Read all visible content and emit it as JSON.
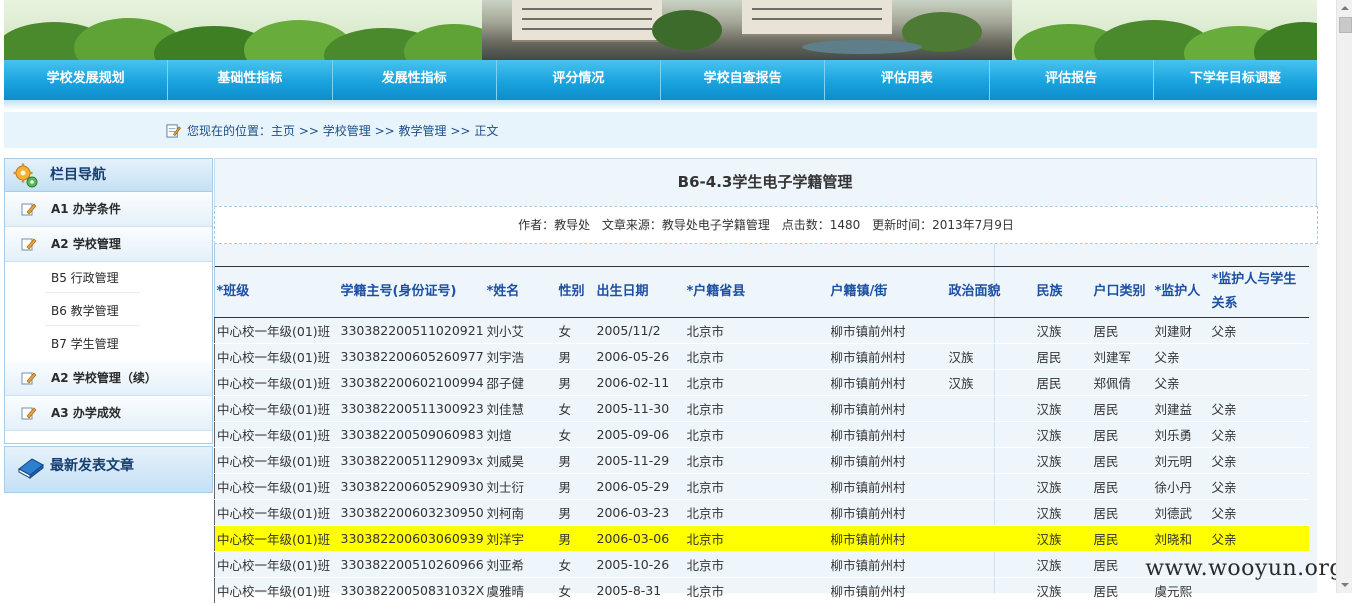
{
  "nav": {
    "items": [
      "学校发展规划",
      "基础性指标",
      "发展性指标",
      "评分情况",
      "学校自查报告",
      "评估用表",
      "评估报告",
      "下学年目标调整"
    ]
  },
  "breadcrumb": {
    "prefix": "您现在的位置：",
    "home": "主页",
    "sep1": " >> ",
    "level1": "学校管理",
    "sep2": " >> ",
    "level2": "教学管理",
    "sep3": " >> ",
    "level3": "正文"
  },
  "sidebar": {
    "title": "栏目导航",
    "items": [
      {
        "label": "A1 办学条件"
      },
      {
        "label": "A2 学校管理"
      },
      {
        "label": "B5 行政管理"
      },
      {
        "label": "B6 教学管理"
      },
      {
        "label": "B7 学生管理"
      },
      {
        "label": "A2 学校管理（续）"
      },
      {
        "label": "A3 办学成效"
      }
    ],
    "latest_title": "最新发表文章"
  },
  "article": {
    "title": "B6-4.3学生电子学籍管理",
    "author": "作者：教导处",
    "source": "文章来源：教导处电子学籍管理",
    "hits": "点击数：1480",
    "updated": "更新时间：2013年7月9日"
  },
  "table": {
    "headers": [
      "*班级",
      "学籍主号(身份证号)",
      "*姓名",
      "性别",
      "出生日期",
      "*户籍省县",
      "户籍镇/街",
      "政治面貌",
      "民族",
      "户口类别",
      "*监护人",
      "*监护人与学生关系"
    ],
    "rows": [
      [
        "中心校一年级(01)班",
        "330382200511020921",
        "刘小艾",
        "女",
        "2005/11/2",
        "北京市",
        "柳市镇前州村",
        "",
        "汉族",
        "居民",
        "刘建财",
        "父亲"
      ],
      [
        "中心校一年级(01)班",
        "330382200605260977",
        "刘宇浩",
        "男",
        "2006-05-26",
        "北京市",
        "柳市镇前州村",
        "汉族",
        "居民",
        "刘建军",
        "父亲",
        ""
      ],
      [
        "中心校一年级(01)班",
        "330382200602100994",
        "邵子健",
        "男",
        "2006-02-11",
        "北京市",
        "柳市镇前州村",
        "汉族",
        "居民",
        "郑佩倩",
        "父亲",
        ""
      ],
      [
        "中心校一年级(01)班",
        "330382200511300923",
        "刘佳慧",
        "女",
        "2005-11-30",
        "北京市",
        "柳市镇前州村",
        "",
        "汉族",
        "居民",
        "刘建益",
        "父亲"
      ],
      [
        "中心校一年级(01)班",
        "330382200509060983",
        "刘煊",
        "女",
        "2005-09-06",
        "北京市",
        "柳市镇前州村",
        "",
        "汉族",
        "居民",
        "刘乐勇",
        "父亲"
      ],
      [
        "中心校一年级(01)班",
        "33038220051129093x",
        "刘威昊",
        "男",
        "2005-11-29",
        "北京市",
        "柳市镇前州村",
        "",
        "汉族",
        "居民",
        "刘元明",
        "父亲"
      ],
      [
        "中心校一年级(01)班",
        "330382200605290930",
        "刘士衍",
        "男",
        "2006-05-29",
        "北京市",
        "柳市镇前州村",
        "",
        "汉族",
        "居民",
        "徐小丹",
        "父亲"
      ],
      [
        "中心校一年级(01)班",
        "330382200603230950",
        "刘柯南",
        "男",
        "2006-03-23",
        "北京市",
        "柳市镇前州村",
        "",
        "汉族",
        "居民",
        "刘德武",
        "父亲"
      ],
      [
        "中心校一年级(01)班",
        "330382200603060939",
        "刘洋宇",
        "男",
        "2006-03-06",
        "北京市",
        "柳市镇前州村",
        "",
        "汉族",
        "居民",
        "刘晓和",
        "父亲"
      ],
      [
        "中心校一年级(01)班",
        "330382200510260966",
        "刘亚希",
        "女",
        "2005-10-26",
        "北京市",
        "柳市镇前州村",
        "",
        "汉族",
        "居民",
        "",
        ""
      ],
      [
        "中心校一年级(01)班",
        "33038220050831032X",
        "虞雅晴",
        "女",
        "2005-8-31",
        "北京市",
        "柳市镇前州村",
        "",
        "汉族",
        "居民",
        "虞元熙",
        ""
      ]
    ],
    "highlight_row": 8,
    "highlight_color": "#ffff00"
  },
  "watermark": "www.wooyun.org",
  "colors": {
    "nav": "#1aa3de",
    "header_text": "#1d4fa3",
    "crumb_text": "#1c4f8a"
  }
}
